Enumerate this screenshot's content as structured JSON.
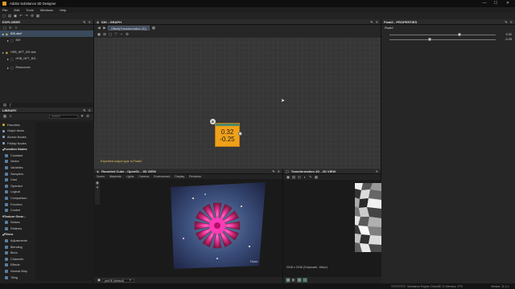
{
  "window": {
    "title": "Adobe Substance 3D Designer",
    "minimize": "—",
    "maximize": "☐",
    "close": "✕"
  },
  "menu": [
    "File",
    "Edit",
    "Tools",
    "Windows",
    "Help"
  ],
  "explorer": {
    "title": "EXPLORER",
    "tree": [
      {
        "label": "IDK.sbs*",
        "indent": 0,
        "selected": true
      },
      {
        "label": "IDK",
        "indent": 1,
        "selected": false
      },
      {
        "label": "HSB_NFT_BG.sbs",
        "indent": 0,
        "selected": false
      },
      {
        "label": "HSB_NFT_BG",
        "indent": 1,
        "selected": false
      },
      {
        "label": "Resources",
        "indent": 1,
        "selected": false
      }
    ]
  },
  "graph": {
    "tab": "IDK - GRAPH",
    "breadcrumb": "Offset(Transformation 2D)",
    "node": {
      "value1": "0.32",
      "value2": "-0.25",
      "badge": "B"
    },
    "warning": "Expected output type is Float2."
  },
  "properties": {
    "title": "Float2 - PROPERTIES",
    "section": "Float2",
    "values": [
      {
        "label": "0.32",
        "fraction": 0.66
      },
      {
        "label": "-0.25",
        "fraction": 0.375
      }
    ]
  },
  "library": {
    "title": "LIBRARY",
    "search_placeholder": "Search",
    "items": [
      {
        "label": "Favorites",
        "kind": "top",
        "color": "#c9a227"
      },
      {
        "label": "Graph Items",
        "kind": "top",
        "color": "#7c9cc0"
      },
      {
        "label": "Atomic Nodes",
        "kind": "top",
        "color": "#7c9cc0"
      },
      {
        "label": "FxMap Nodes",
        "kind": "top",
        "color": "#7c9cc0"
      },
      {
        "label": "Function Nodes",
        "kind": "cat"
      },
      {
        "label": "Constant",
        "kind": "sub"
      },
      {
        "label": "Vector",
        "kind": "sub"
      },
      {
        "label": "Variables",
        "kind": "sub"
      },
      {
        "label": "Samplers",
        "kind": "sub"
      },
      {
        "label": "Cast",
        "kind": "sub"
      },
      {
        "label": "Operator",
        "kind": "sub"
      },
      {
        "label": "Logical",
        "kind": "sub"
      },
      {
        "label": "Comparison",
        "kind": "sub"
      },
      {
        "label": "Function",
        "kind": "sub"
      },
      {
        "label": "Control",
        "kind": "sub"
      },
      {
        "label": "Texture Gene...",
        "kind": "cat"
      },
      {
        "label": "Noises",
        "kind": "sub"
      },
      {
        "label": "Patterns",
        "kind": "sub"
      },
      {
        "label": "Filters",
        "kind": "cat"
      },
      {
        "label": "Adjustments",
        "kind": "sub"
      },
      {
        "label": "Blending",
        "kind": "sub"
      },
      {
        "label": "Blurs",
        "kind": "sub"
      },
      {
        "label": "Channels",
        "kind": "sub"
      },
      {
        "label": "Effects",
        "kind": "sub"
      },
      {
        "label": "Normal Map",
        "kind": "sub"
      },
      {
        "label": "Tiling",
        "kind": "sub"
      },
      {
        "label": "Transforms",
        "kind": "sub"
      }
    ]
  },
  "view3d": {
    "title": "Rounded Cube - OpenGL - 3D VIEW",
    "menu": [
      "Scene",
      "Materials",
      "Lights",
      "Camera",
      "Environment",
      "Display",
      "Renderer"
    ],
    "material_select": "pbrOE (default)",
    "signature": "Gusto"
  },
  "view2d": {
    "title": "Transformation 2D - 2D VIEW",
    "status": "2048 x 2048 (Grayscale, 16bpc)"
  },
  "statusbar": {
    "engine": "Substance Engine: Direct3D 11  Memory: 27%",
    "version": "Version: 11.3.1"
  }
}
